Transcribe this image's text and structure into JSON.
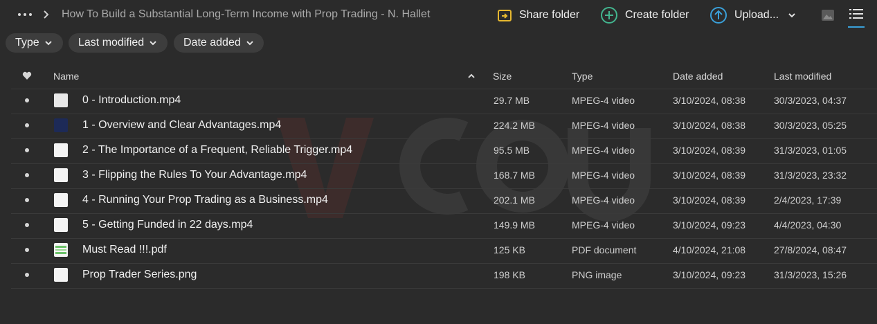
{
  "breadcrumb": {
    "title": "How To Build a Substantial Long-Term Income with Prop Trading - N. Hallet"
  },
  "actions": {
    "share_folder": "Share folder",
    "create_folder": "Create folder",
    "upload": "Upload..."
  },
  "filters": {
    "type": "Type",
    "last_modified": "Last modified",
    "date_added": "Date added"
  },
  "table": {
    "columns": {
      "name": "Name",
      "size": "Size",
      "type": "Type",
      "date_added": "Date added",
      "last_modified": "Last modified"
    },
    "rows": [
      {
        "name": "0 - Introduction.mp4",
        "size": "29.7 MB",
        "type": "MPEG-4 video",
        "date_added": "3/10/2024, 08:38",
        "last_modified": "30/3/2023, 04:37"
      },
      {
        "name": "1 - Overview and Clear Advantages.mp4",
        "size": "224.2 MB",
        "type": "MPEG-4 video",
        "date_added": "3/10/2024, 08:38",
        "last_modified": "30/3/2023, 05:25"
      },
      {
        "name": "2 - The Importance of a Frequent, Reliable Trigger.mp4",
        "size": "95.5 MB",
        "type": "MPEG-4 video",
        "date_added": "3/10/2024, 08:39",
        "last_modified": "31/3/2023, 01:05"
      },
      {
        "name": "3 - Flipping the Rules To Your Advantage.mp4",
        "size": "168.7 MB",
        "type": "MPEG-4 video",
        "date_added": "3/10/2024, 08:39",
        "last_modified": "31/3/2023, 23:32"
      },
      {
        "name": "4 - Running Your Prop Trading as a Business.mp4",
        "size": "202.1 MB",
        "type": "MPEG-4 video",
        "date_added": "3/10/2024, 08:39",
        "last_modified": "2/4/2023, 17:39"
      },
      {
        "name": "5 - Getting Funded in 22 days.mp4",
        "size": "149.9 MB",
        "type": "MPEG-4 video",
        "date_added": "3/10/2024, 09:23",
        "last_modified": "4/4/2023, 04:30"
      },
      {
        "name": "Must Read !!!.pdf",
        "size": "125 KB",
        "type": "PDF document",
        "date_added": "4/10/2024, 21:08",
        "last_modified": "27/8/2024, 08:47"
      },
      {
        "name": "Prop Trader Series.png",
        "size": "198 KB",
        "type": "PNG image",
        "date_added": "3/10/2024, 09:23",
        "last_modified": "31/3/2023, 15:26"
      }
    ]
  },
  "icons": {
    "more": "more-horizontal-icon",
    "share": "share-folder-icon",
    "create": "create-folder-icon",
    "upload": "upload-icon",
    "image_view": "image-view-icon",
    "list_view": "list-view-icon",
    "favorite": "heart-icon"
  },
  "colors": {
    "background": "#2b2b2b",
    "accent_yellow": "#e6b830",
    "accent_green": "#43b58f",
    "accent_blue": "#3aa0d9"
  }
}
